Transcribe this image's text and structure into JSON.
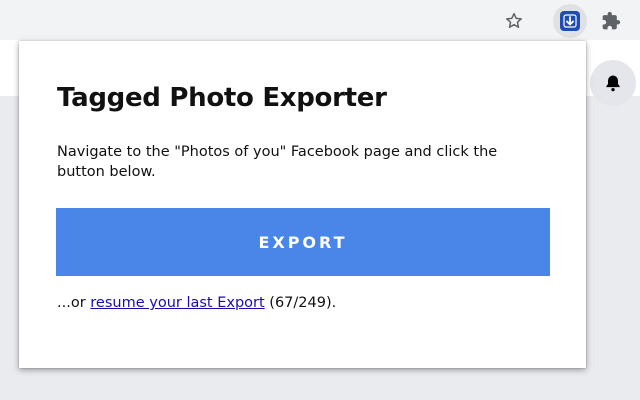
{
  "browser": {
    "icons": {
      "bookmark_star": "star-outline-icon",
      "extension": "download-arrow-icon",
      "extensions_menu": "puzzle-piece-icon",
      "notifications": "bell-icon"
    },
    "colors": {
      "extension_icon_bg": "#1f4db3",
      "toolbar_bg": "#f1f3f4"
    }
  },
  "popup": {
    "title": "Tagged Photo Exporter",
    "description": "Navigate to the \"Photos of you\" Facebook page and click the button below.",
    "export_button_label": "EXPORT",
    "resume_prefix": "...or ",
    "resume_link_text": "resume your last Export",
    "resume_suffix": " (67/249).",
    "colors": {
      "export_button_bg": "#4a85e8",
      "link": "#1a0dab"
    }
  }
}
